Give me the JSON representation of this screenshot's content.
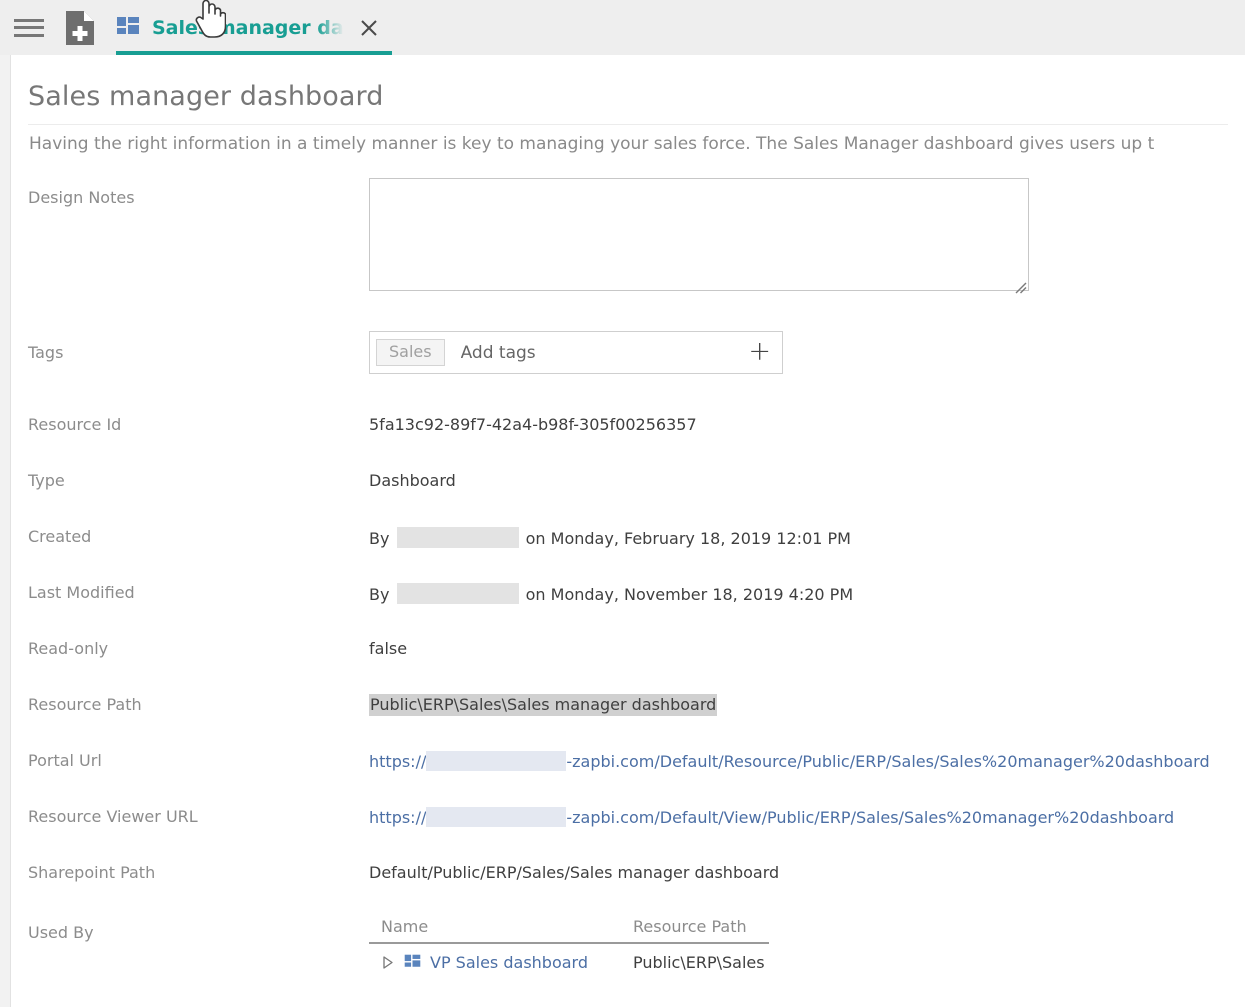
{
  "topbar": {
    "menu_icon": "hamburger-menu-icon",
    "new_document_icon": "new-document-icon",
    "tab": {
      "icon": "dashboard-icon",
      "label": "Sales manager dashb",
      "close_icon": "close-icon"
    },
    "cursor": "pointing-hand-cursor"
  },
  "page": {
    "title": "Sales manager dashboard",
    "description": "Having the right information in a timely manner is key to managing your sales force. The Sales Manager dashboard gives users up t"
  },
  "fields": {
    "design_notes": {
      "label": "Design Notes",
      "value": "",
      "placeholder": ""
    },
    "tags": {
      "label": "Tags",
      "chips": [
        "Sales"
      ],
      "placeholder": "Add tags",
      "value": "",
      "add_icon": "plus-icon"
    },
    "resource_id": {
      "label": "Resource Id",
      "value": "5fa13c92-89f7-42a4-b98f-305f00256357"
    },
    "type": {
      "label": "Type",
      "value": "Dashboard"
    },
    "created": {
      "label": "Created",
      "by_prefix": "By",
      "author_redacted": true,
      "suffix": "on Monday, February 18, 2019 12:01 PM"
    },
    "last_modified": {
      "label": "Last Modified",
      "by_prefix": "By",
      "author_redacted": true,
      "suffix": "on Monday, November 18, 2019 4:20 PM"
    },
    "read_only": {
      "label": "Read-only",
      "value": "false"
    },
    "resource_path": {
      "label": "Resource Path",
      "value": "Public\\ERP\\Sales\\Sales manager dashboard",
      "selected": true
    },
    "portal_url": {
      "label": "Portal Url",
      "prefix": "https://",
      "host_redacted": true,
      "suffix": "-zapbi.com/Default/Resource/Public/ERP/Sales/Sales%20manager%20dashboard"
    },
    "resource_viewer_url": {
      "label": "Resource Viewer URL",
      "prefix": "https://",
      "host_redacted": true,
      "suffix": "-zapbi.com/Default/View/Public/ERP/Sales/Sales%20manager%20dashboard"
    },
    "sharepoint_path": {
      "label": "Sharepoint Path",
      "value": "Default/Public/ERP/Sales/Sales manager dashboard"
    },
    "used_by": {
      "label": "Used By",
      "columns": [
        "Name",
        "Resource Path"
      ],
      "rows": [
        {
          "expand_icon": "expand-triangle-icon",
          "icon": "dashboard-icon",
          "name": "VP Sales dashboard",
          "resource_path": "Public\\ERP\\Sales"
        }
      ]
    }
  },
  "colors": {
    "accent_teal": "#189e93",
    "link_blue": "#4c6fa5",
    "icon_blue": "#5a84bd",
    "label_gray": "#8c8c8c",
    "topbar_gray": "#eeeeee"
  }
}
